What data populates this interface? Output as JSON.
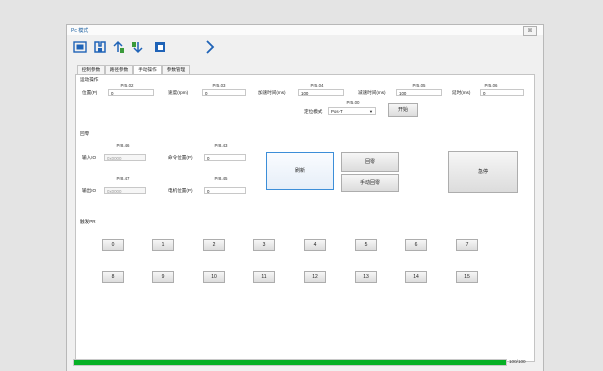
{
  "window": {
    "title": "Pc 模式",
    "close_label": "☒"
  },
  "toolbar": {
    "icons": [
      "open-icon",
      "save-icon",
      "upload-icon",
      "download-icon",
      "bookmark-icon",
      "next-icon"
    ],
    "accent": "#1f63b7"
  },
  "tabs": [
    {
      "label": "控制参数",
      "active": false
    },
    {
      "label": "路径参数",
      "active": false
    },
    {
      "label": "手动操作",
      "active": true
    },
    {
      "label": "参数管理",
      "active": false
    }
  ],
  "jog": {
    "header": "运动操作",
    "fields": [
      {
        "code": "Pr5.02",
        "label": "位置(P)",
        "value": "0"
      },
      {
        "code": "Pr5.03",
        "label": "速度(rpm)",
        "value": "0"
      },
      {
        "code": "Pr5.04",
        "label": "加速时间(ms)",
        "value": "100"
      },
      {
        "code": "Pr5.05",
        "label": "减速时间(ms)",
        "value": "100"
      },
      {
        "code": "Pr5.06",
        "label": "延时(ms)",
        "value": "0"
      }
    ],
    "mode_code": "Pr5.00",
    "mode_label": "定位模式",
    "mode_value": "Pos-T",
    "start_button": "开始"
  },
  "homing": {
    "header": "回零",
    "input_io": {
      "code": "Pr8.46",
      "label": "输入IO",
      "value": "0x0000"
    },
    "output_io": {
      "code": "Pr8.47",
      "label": "输出IO",
      "value": "0x0000"
    },
    "cmd_pos": {
      "code": "Pr8.43",
      "label": "命令位置(P)",
      "value": "0"
    },
    "motor_pos": {
      "code": "Pr8.45",
      "label": "电机位置(P)",
      "value": "0"
    },
    "refresh_button": "刷新",
    "home_button": "回零",
    "manual_home_button": "手动回零",
    "estop_button": "急停"
  },
  "trigger": {
    "header": "触发PR",
    "buttons": [
      "0",
      "1",
      "2",
      "3",
      "4",
      "5",
      "6",
      "7",
      "8",
      "9",
      "10",
      "11",
      "12",
      "13",
      "14",
      "15"
    ]
  },
  "progress": {
    "value": 1.0,
    "text": "100/100",
    "color": "#06b025"
  }
}
